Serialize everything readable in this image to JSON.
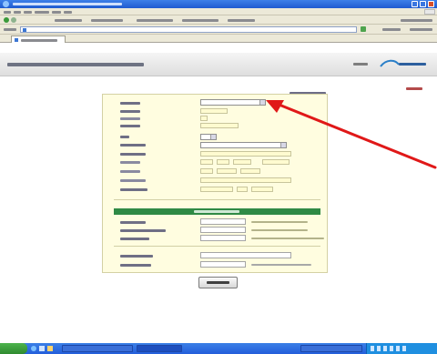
{
  "window": {
    "title": "",
    "colors": {
      "titlebar": "#2a67dc",
      "chrome": "#ece9d8",
      "close_button": "#d6502c"
    }
  },
  "browser": {
    "menu_items": [
      "",
      "",
      "",
      "",
      "",
      ""
    ],
    "address_url": "",
    "tab_title": ""
  },
  "page": {
    "title": "",
    "header_links": [
      "",
      ""
    ],
    "required_note": "",
    "logout_link": "",
    "colors": {
      "accent_red": "#b44b4b",
      "section_green": "#2f8a45",
      "form_bg": "#fffde0"
    }
  },
  "form": {
    "user_type": {
      "label": "",
      "value": ""
    },
    "first_name": {
      "label": ""
    },
    "middle_initial": {
      "label": ""
    },
    "last_name": {
      "label": ""
    },
    "title": {
      "label": "",
      "value": ""
    },
    "school_district": {
      "label": "",
      "value": ""
    },
    "email_address": {
      "label": ""
    },
    "school_phone": {
      "label": ""
    },
    "other_phone": {
      "label": ""
    },
    "mailing_address": {
      "label": ""
    },
    "city_state_zip": {
      "label": ""
    },
    "section_title": "",
    "username": {
      "label": "",
      "hint": ""
    },
    "password": {
      "label": "",
      "hint": ""
    },
    "verify_password": {
      "label": "",
      "hint": ""
    },
    "security_question": {
      "label": ""
    },
    "security_answer": {
      "label": "",
      "hint": ""
    },
    "submit_label": ""
  },
  "taskbar": {
    "start_label": "",
    "items": [
      "",
      "",
      ""
    ],
    "clock": ""
  },
  "annotation": {
    "type": "arrow",
    "color": "#e01818",
    "points_to": "user-type-select"
  }
}
